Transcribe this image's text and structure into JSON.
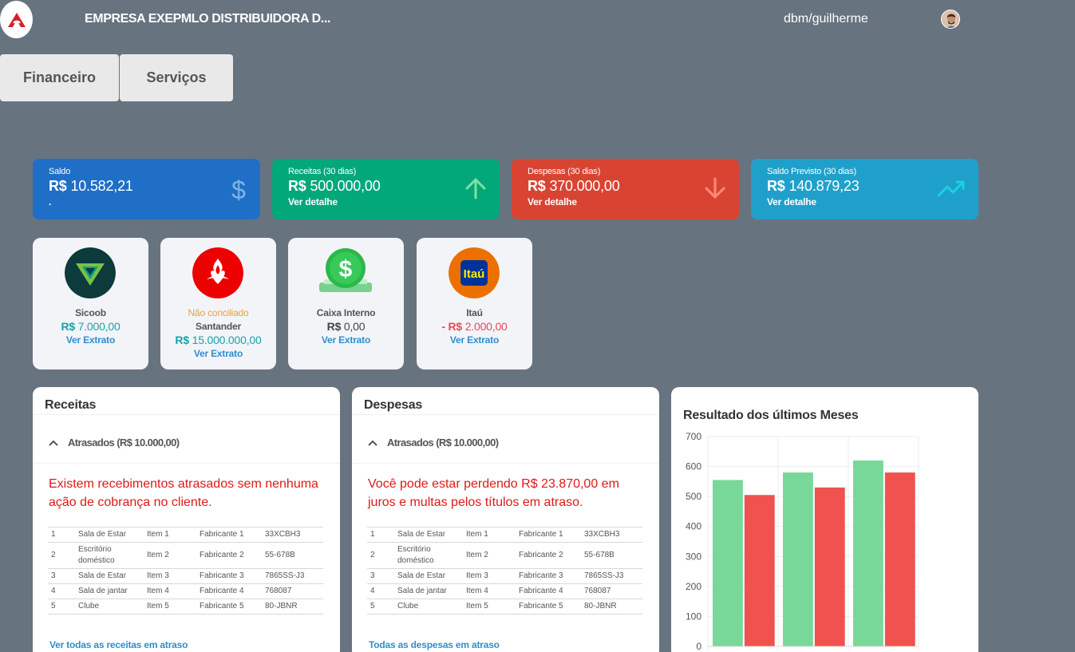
{
  "header": {
    "company": "EMPRESA EXEPMLO DISTRIBUIDORA D...",
    "user": "dbm/guilherme",
    "logo_icon": "brand-logo-icon",
    "avatar_icon": "user-avatar-icon"
  },
  "tabs": [
    {
      "label": "Financeiro"
    },
    {
      "label": "Serviços"
    }
  ],
  "kpis": [
    {
      "label": "Saldo",
      "currency": "R$",
      "value": "10.582,21",
      "link": ".",
      "icon": "dollar-icon",
      "color": "#1f6fc7"
    },
    {
      "label": "Receitas (30 dias)",
      "currency": "R$",
      "value": "500.000,00",
      "link": "Ver detalhe",
      "icon": "arrow-up-icon",
      "color": "#03a87a"
    },
    {
      "label": "Despesas (30 dias)",
      "currency": "R$",
      "value": "370.000,00",
      "link": "Ver detalhe",
      "icon": "arrow-down-icon",
      "color": "#d94432"
    },
    {
      "label": "Saldo Previsto (30 dias)",
      "currency": "R$",
      "value": "140.879,23",
      "link": "Ver detalhe",
      "icon": "trending-up-icon",
      "color": "#1fa0cb"
    }
  ],
  "banks": [
    {
      "name": "Sicoob",
      "warning": "",
      "prefix": "R$",
      "value": "7.000,00",
      "link": "Ver Extrato",
      "icon": "sicoob-logo-icon"
    },
    {
      "name": "Santander",
      "warning": "Não conciliado",
      "prefix": "R$",
      "value": "15.000.000,00",
      "link": "Ver Extrato",
      "icon": "santander-logo-icon"
    },
    {
      "name": "Caixa Interno",
      "warning": "",
      "prefix": "R$",
      "value": "0,00",
      "link": "Ver Extrato",
      "icon": "cash-register-icon"
    },
    {
      "name": "Itaú",
      "warning": "",
      "prefix": "- R$",
      "value": "2.000,00",
      "link": "Ver Extrato",
      "icon": "itau-logo-icon",
      "logo_text": "Itaú"
    }
  ],
  "receitas": {
    "title": "Receitas",
    "accordion": "Atrasados (R$ 10.000,00)",
    "message": "Existem recebimentos atrasados sem nenhuma ação de cobrança no cliente.",
    "rows": [
      [
        "1",
        "Sala de Estar",
        "Item 1",
        "Fabricante 1",
        "33XCBH3"
      ],
      [
        "2",
        "Escritório doméstico",
        "Item 2",
        "Fabricante 2",
        "55-678B"
      ],
      [
        "3",
        "Sala de Estar",
        "Item 3",
        "Fabricante 3",
        "7865SS-J3"
      ],
      [
        "4",
        "Sala de jantar",
        "Item 4",
        "Fabricante 4",
        "768087"
      ],
      [
        "5",
        "Clube",
        "Item 5",
        "Fabricante 5",
        "80-JBNR"
      ]
    ],
    "more_link": "Ver todas as receitas em atraso"
  },
  "despesas": {
    "title": "Despesas",
    "accordion": "Atrasados (R$ 10.000,00)",
    "message": "Você pode estar perdendo R$ 23.870,00 em juros e multas pelos títulos em atraso.",
    "rows": [
      [
        "1",
        "Sala de Estar",
        "Item 1",
        "Fabricante 1",
        "33XCBH3"
      ],
      [
        "2",
        "Escritório doméstico",
        "Item 2",
        "Fabricante 2",
        "55-678B"
      ],
      [
        "3",
        "Sala de Estar",
        "Item 3",
        "Fabricante 3",
        "7865SS-J3"
      ],
      [
        "4",
        "Sala de jantar",
        "Item 4",
        "Fabricante 4",
        "768087"
      ],
      [
        "5",
        "Clube",
        "Item 5",
        "Fabricante 5",
        "80-JBNR"
      ]
    ],
    "more_link": "Todas as despesas em atraso"
  },
  "chart_data": {
    "type": "bar",
    "title": "Resultado dos últimos Meses",
    "categories": [
      "",
      "",
      ""
    ],
    "series": [
      {
        "values": [
          555,
          580,
          620
        ],
        "color": "#77d89a"
      },
      {
        "values": [
          505,
          530,
          580
        ],
        "color": "#f0524f"
      }
    ],
    "ylim": [
      0,
      700
    ],
    "yticks": [
      "0",
      "100",
      "200",
      "300",
      "400",
      "500",
      "600",
      "700"
    ],
    "grid": true
  }
}
